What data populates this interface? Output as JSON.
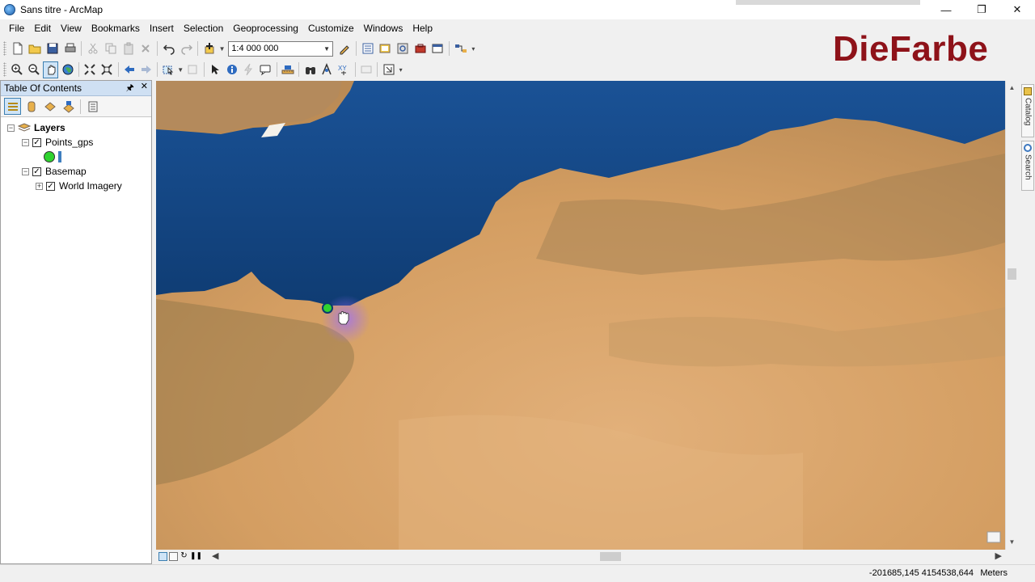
{
  "window": {
    "title": "Sans titre - ArcMap",
    "minimize": "—",
    "restore": "❐",
    "close": "✕"
  },
  "menu": [
    "File",
    "Edit",
    "View",
    "Bookmarks",
    "Insert",
    "Selection",
    "Geoprocessing",
    "Customize",
    "Windows",
    "Help"
  ],
  "toolbar": {
    "scale_value": "1:4 000 000"
  },
  "watermark": "DieFarbe",
  "toc": {
    "title": "Table Of Contents",
    "pin": "🖈",
    "close": "✕",
    "root_layer": "Layers",
    "layers": [
      {
        "name": "Points_gps",
        "checked": true,
        "expander": "−"
      },
      {
        "name": "Basemap",
        "checked": true,
        "expander": "−"
      }
    ],
    "sublayer": {
      "name": "World Imagery",
      "checked": true,
      "expander": "+"
    },
    "gps_color": "#2fd32f"
  },
  "side_tabs": {
    "catalog": "Catalog",
    "search": "Search"
  },
  "status": {
    "coordinates": "-201685,145  4154538,644",
    "units": "Meters"
  },
  "map": {
    "sea_color": "#174a86",
    "land_color": "#d8a46a",
    "point_color": "#2fd32f"
  }
}
